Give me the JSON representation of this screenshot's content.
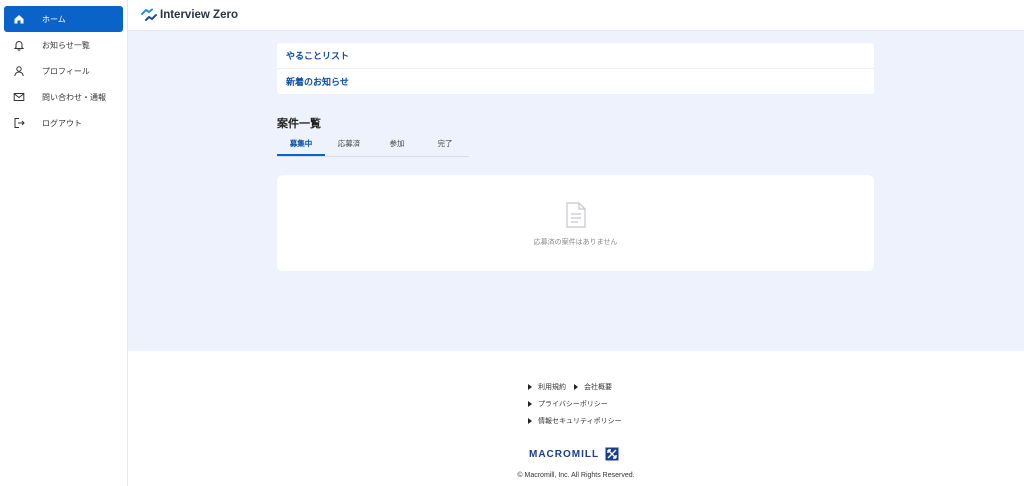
{
  "sidebar": {
    "items": [
      {
        "label": "ホーム",
        "icon": "home-icon",
        "active": true
      },
      {
        "label": "お知らせ一覧",
        "icon": "bell-icon",
        "active": false
      },
      {
        "label": "プロフィール",
        "icon": "user-icon",
        "active": false
      },
      {
        "label": "問い合わせ・通報",
        "icon": "mail-icon",
        "active": false
      },
      {
        "label": "ログアウト",
        "icon": "logout-icon",
        "active": false
      }
    ]
  },
  "header": {
    "brand": "Interview Zero"
  },
  "main": {
    "todo_items": [
      {
        "label": "やることリスト"
      },
      {
        "label": "新着のお知らせ"
      }
    ],
    "section_title": "案件一覧",
    "tabs": [
      {
        "label": "募集中",
        "active": true
      },
      {
        "label": "応募済",
        "active": false
      },
      {
        "label": "参加",
        "active": false
      },
      {
        "label": "完了",
        "active": false
      }
    ],
    "empty_message": "応募済の案件はありません"
  },
  "footer": {
    "links_row1": [
      "利用規約",
      "会社概要"
    ],
    "links_row2": [
      "プライバシーポリシー"
    ],
    "links_row3": [
      "情報セキュリティポリシー"
    ],
    "brand": "MACROMILL",
    "copyright": "© Macromill, Inc. All Rights Reserved."
  },
  "colors": {
    "accent": "#0a63c9",
    "link": "#0a4ea0",
    "background": "#edf2fc"
  }
}
